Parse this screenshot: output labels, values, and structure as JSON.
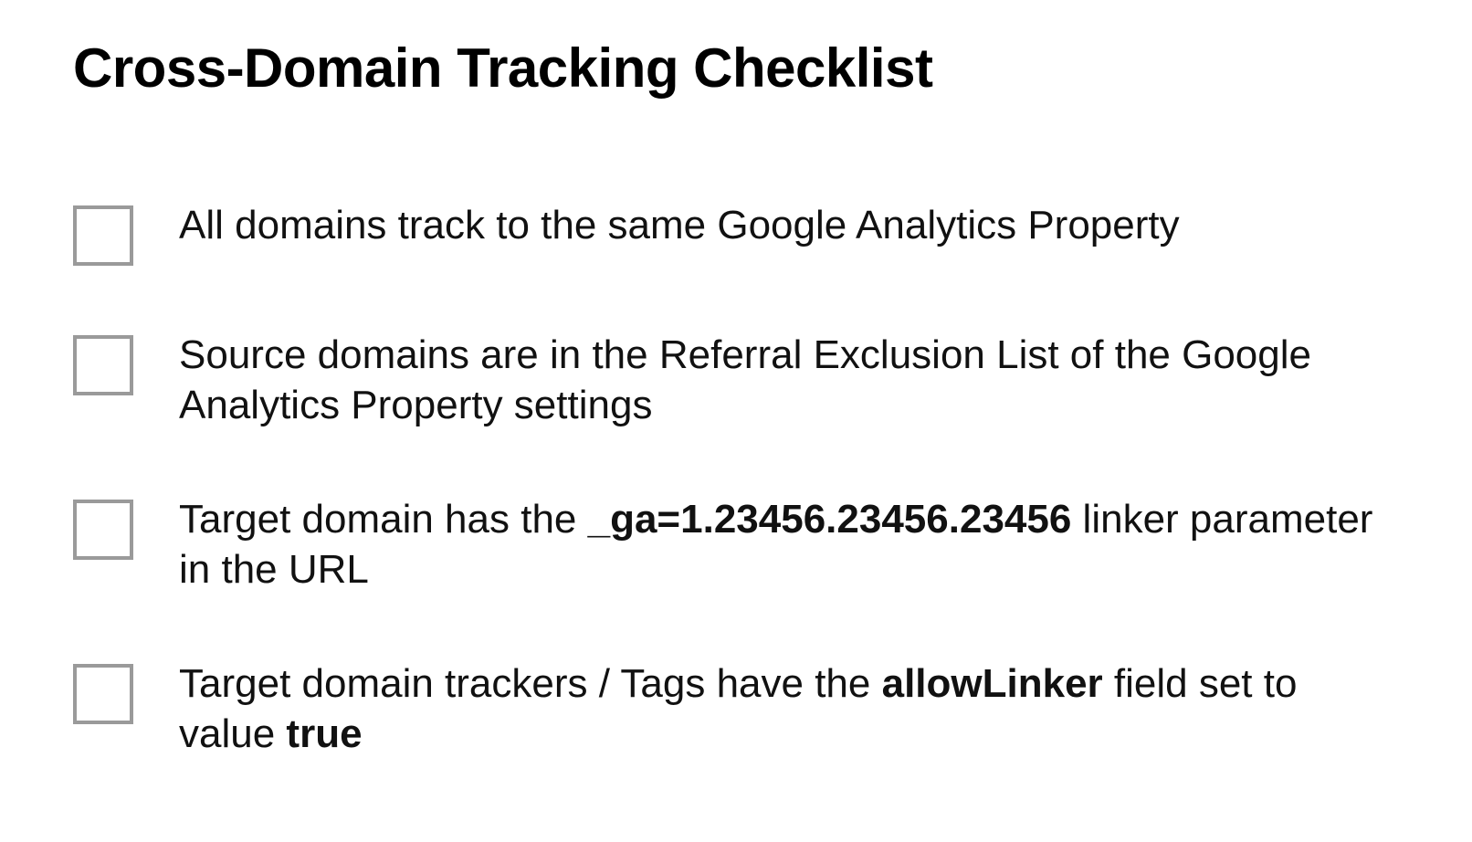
{
  "title": "Cross-Domain Tracking Checklist",
  "items": [
    {
      "text_pre": "All domains track to the same Google Analytics Property",
      "bold1": "",
      "text_mid": "",
      "bold2": "",
      "text_post": ""
    },
    {
      "text_pre": "Source domains are in the Referral Exclusion List of the Google Analytics Property settings",
      "bold1": "",
      "text_mid": "",
      "bold2": "",
      "text_post": ""
    },
    {
      "text_pre": "Target domain has the ",
      "bold1": "_ga=1.23456.23456.23456",
      "text_mid": " linker parameter in the URL",
      "bold2": "",
      "text_post": ""
    },
    {
      "text_pre": "Target domain trackers / Tags have the ",
      "bold1": "allowLinker",
      "text_mid": " field set to value ",
      "bold2": "true",
      "text_post": ""
    }
  ]
}
